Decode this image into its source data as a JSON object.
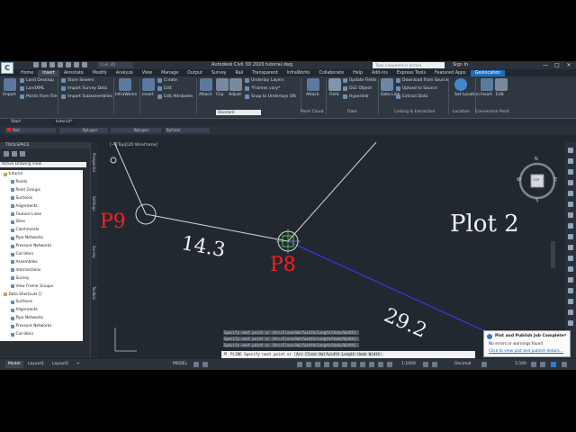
{
  "titlebar": {
    "app_logo": "C",
    "workspace": "Civil 3D",
    "title": "Autodesk Civil 3D 2020    tutorial.dwg",
    "search_placeholder": "Type a keyword or phrase",
    "sign_in": "Sign In",
    "win_min": "—",
    "win_max": "□",
    "win_close": "✕"
  },
  "tabs": [
    "Home",
    "Insert",
    "Annotate",
    "Modify",
    "Analyze",
    "View",
    "Manage",
    "Output",
    "Survey",
    "Rail",
    "Transparent",
    "InfraWorks",
    "Collaborate",
    "Help",
    "Add-ins",
    "Express Tools",
    "Featured Apps",
    "Geolocation"
  ],
  "ribbon": {
    "import_label": "Import",
    "land_desktop": "Land Desktop",
    "landxml": "LandXML",
    "points_from_file": "Points from File",
    "survey_group": "Survey Group",
    "store_sewers": "Store Sewers",
    "import_survey_data": "Import Survey Data",
    "import_subassemblies": "Import Subassemblies",
    "infraworks": "InfraWorks",
    "insert": "Insert",
    "create": "Create",
    "edit": "Edit",
    "edit_attributes": "Edit Attributes",
    "attach": "Attach",
    "clip": "Clip",
    "adjust": "Adjust",
    "underlay_layers": "Underlay Layers",
    "frames_vary": "*Frames vary*",
    "snap_to_underlays": "Snap to Underlays ON",
    "attach2": "Attach",
    "field": "Field",
    "update_fields": "Update Fields",
    "ole_object": "OLE Object",
    "hyperlink": "Hyperlink",
    "data_link": "Data Link",
    "download_from_source": "Download from Source",
    "upload_to_source": "Upload to Source",
    "extract_data": "Extract  Data",
    "set_location": "Set Location",
    "insert2": "Insert",
    "edit2": "Edit",
    "panels": {
      "point_cloud": "Point Cloud",
      "data": "Data",
      "linking_extraction": "Linking & Extraction",
      "location": "Location",
      "connection_point": "Connection Point"
    }
  },
  "doc_tabs": [
    "Start",
    "tutorial*"
  ],
  "propbar": {
    "color": "Red",
    "linetype": "ByLayer",
    "lineweight": "ByLayer",
    "plotstyle": "ByColor",
    "layer": "Standard"
  },
  "toolspace": {
    "title": "TOOLSPACE",
    "view_select": "Active Drawing View",
    "side_tabs": [
      "Prospector",
      "Settings",
      "Survey",
      "Toolbox"
    ],
    "tree": [
      {
        "label": "tutorial",
        "depth": 0,
        "folder": true
      },
      {
        "label": "Points",
        "depth": 1
      },
      {
        "label": "Point Groups",
        "depth": 1
      },
      {
        "label": "Surfaces",
        "depth": 1
      },
      {
        "label": "Alignments",
        "depth": 1
      },
      {
        "label": "Feature Lines",
        "depth": 1
      },
      {
        "label": "Sites",
        "depth": 1
      },
      {
        "label": "Catchments",
        "depth": 1
      },
      {
        "label": "Pipe Networks",
        "depth": 1
      },
      {
        "label": "Pressure Networks",
        "depth": 1
      },
      {
        "label": "Corridors",
        "depth": 1
      },
      {
        "label": "Assemblies",
        "depth": 1
      },
      {
        "label": "Intersections",
        "depth": 1
      },
      {
        "label": "Survey",
        "depth": 1
      },
      {
        "label": "View Frame Groups",
        "depth": 1
      },
      {
        "label": "Data Shortcuts []",
        "depth": 0,
        "folder": true
      },
      {
        "label": "Surfaces",
        "depth": 1
      },
      {
        "label": "Alignments",
        "depth": 1
      },
      {
        "label": "Pipe Networks",
        "depth": 1
      },
      {
        "label": "Pressure Networks",
        "depth": 1
      },
      {
        "label": "Corridors",
        "depth": 1
      }
    ]
  },
  "viewport": {
    "label": "[−][Top][2D Wireframe]",
    "p9": "P9",
    "p8": "P8",
    "len1": "14.3",
    "len2": "29.2",
    "plot": "Plot 2",
    "colors": {
      "red": "#ff1f1f",
      "blue_line": "#3b3bff",
      "line": "#d9d9d9"
    }
  },
  "viewcube": {
    "n": "N",
    "s": "S",
    "e": "E",
    "w": "W",
    "top": "TOP"
  },
  "command": {
    "history": [
      "Specify next point or [Arc/Close/Halfwidth/Length/Undo/Width]:",
      "Specify next point or [Arc/Close/Halfwidth/Length/Undo/Width]:",
      "Specify next point or [Arc/Close/Halfwidth/Length/Undo/Width]:"
    ],
    "prompt_prefix": "PLINE Specify next point or [",
    "options": "Arc Close Halfwidth Length Undo Width",
    "prompt_suffix": "]:"
  },
  "toast": {
    "title": "Plot and Publish Job Complete",
    "body": "No errors or warnings found",
    "link": "Click to view plot and publish details..."
  },
  "statusbar": {
    "layouts": [
      "Model",
      "Layout1",
      "Layout2"
    ],
    "add": "+",
    "model": "MODEL",
    "scale": "1:1000",
    "units": "Decimal",
    "value": "3.500"
  }
}
